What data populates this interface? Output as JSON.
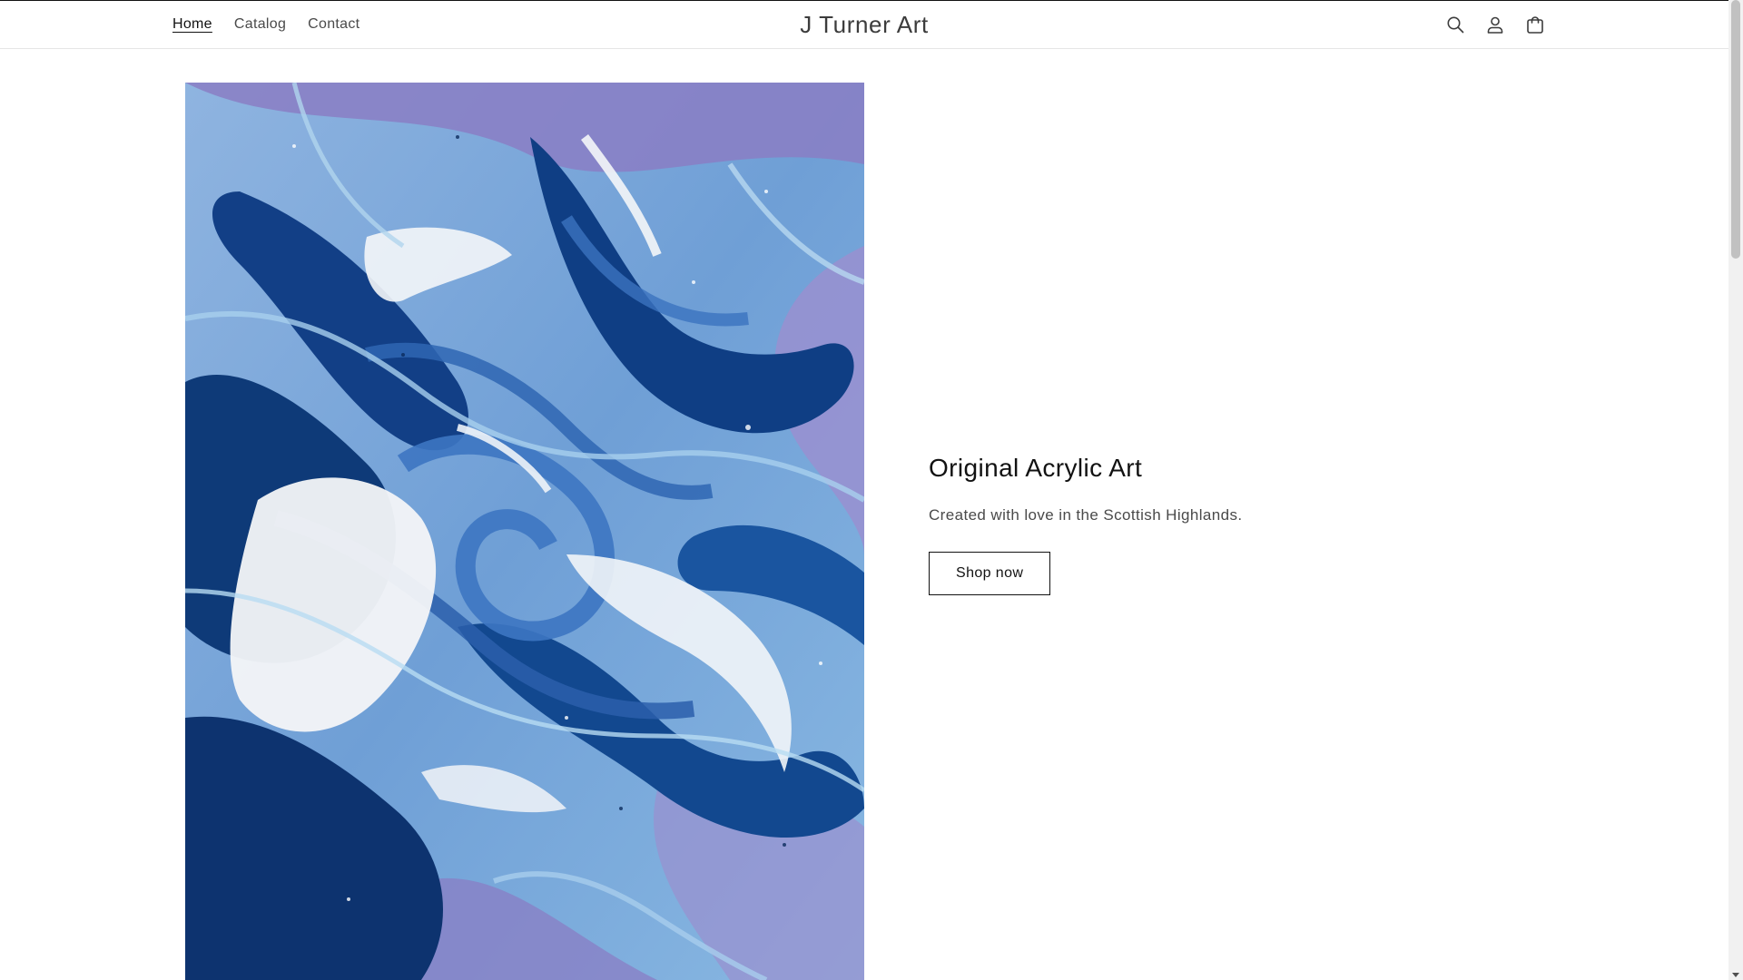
{
  "header": {
    "nav": [
      {
        "label": "Home",
        "active": true
      },
      {
        "label": "Catalog",
        "active": false
      },
      {
        "label": "Contact",
        "active": false
      }
    ],
    "logo_text": "J Turner Art",
    "icons": [
      "search-icon",
      "account-icon",
      "cart-icon"
    ]
  },
  "hero": {
    "image_subject": "blue, purple and white acrylic pour painting",
    "title": "Original Acrylic Art",
    "subtitle": "Created with love in the Scottish Highlands.",
    "button_label": "Shop now"
  },
  "colors": {
    "text": "#121212",
    "muted_text": "#4a4a4a",
    "border": "#e6e6e6",
    "paint_navy": "#0e3a78",
    "paint_blue": "#3d76c2",
    "paint_light_blue": "#8fc0e4",
    "paint_purple": "#8a7ec4",
    "paint_white": "#f4f6f8"
  }
}
